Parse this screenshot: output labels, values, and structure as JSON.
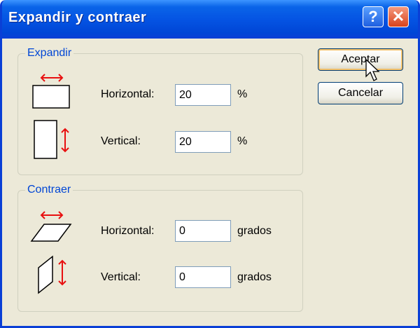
{
  "window": {
    "title": "Expandir y contraer"
  },
  "titlebar": {
    "help_glyph": "?",
    "close_glyph": "✕"
  },
  "expand": {
    "legend": "Expandir",
    "horizontal_label": "Horizontal:",
    "horizontal_value": "20",
    "horizontal_unit": "%",
    "vertical_label": "Vertical:",
    "vertical_value": "20",
    "vertical_unit": "%"
  },
  "contract": {
    "legend": "Contraer",
    "horizontal_label": "Horizontal:",
    "horizontal_value": "0",
    "horizontal_unit": "grados",
    "vertical_label": "Vertical:",
    "vertical_value": "0",
    "vertical_unit": "grados"
  },
  "buttons": {
    "ok_label": "Aceptar",
    "cancel_label": "Cancelar"
  },
  "colors": {
    "accent": "#0046d5",
    "arrow": "#e81010",
    "titlebar": "#0054e3"
  },
  "icons": [
    "expand-horizontal-icon",
    "expand-vertical-icon",
    "skew-horizontal-icon",
    "skew-vertical-icon",
    "help-icon",
    "close-icon",
    "mouse-cursor-icon"
  ]
}
